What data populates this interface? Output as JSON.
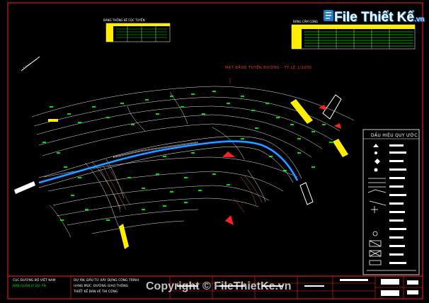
{
  "watermark": {
    "brand": "File Thiết Kế",
    "suffix": ".vn",
    "copyright": "Copyright © FileThietKe.vn"
  },
  "drawing": {
    "center_title": "MẶT BẰNG TUYẾN ĐƯỜNG - TỶ LỆ 1/1000",
    "left_table_title": "BẢNG THỐNG KÊ CỌC TUYẾN",
    "right_table_title": "BẢNG CẮM CONG"
  },
  "legend": {
    "title": "DẤU HIỆU QUY ƯỚC"
  },
  "title_block": {
    "agency": "CỤC ĐƯỜNG BỘ VIỆT NAM",
    "agency_sub": "BAN QUẢN LÝ DỰ ÁN",
    "project": "DỰ ÁN: ĐẦU TƯ XÂY DỰNG CÔNG TRÌNH",
    "item": "HẠNG MỤC: ĐƯỜNG GIAO THÔNG",
    "sheet": "THIẾT KẾ BẢN VẼ THI CÔNG"
  },
  "colors": {
    "frame": "#ff2020",
    "road": "#2a5bff",
    "contour": "#ffffff",
    "survey": "#00dd00",
    "legend_border": "#ffffff",
    "watermark": "#1a7fd0",
    "marker_yellow": "#ffee00"
  }
}
